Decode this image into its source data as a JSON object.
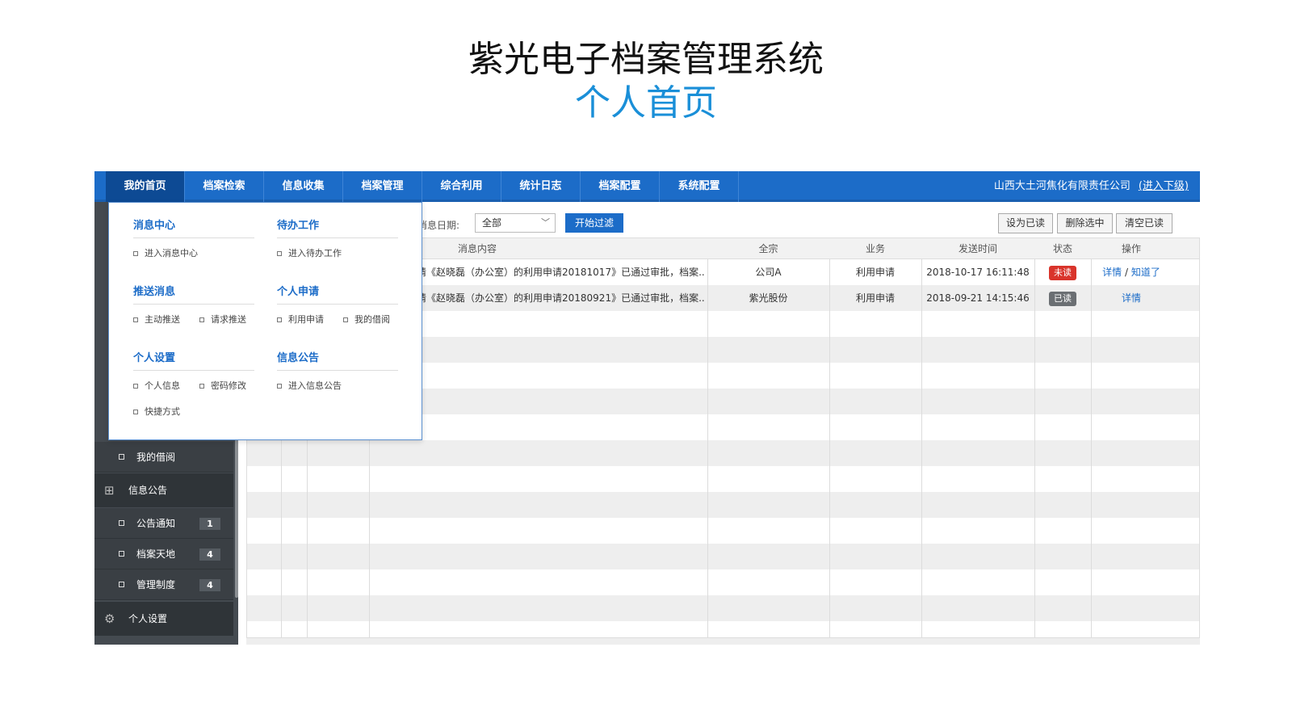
{
  "slide": {
    "title": "紫光电子档案管理系统",
    "subtitle": "个人首页"
  },
  "topnav": {
    "tabs": [
      "我的首页",
      "档案检索",
      "信息收集",
      "档案管理",
      "综合利用",
      "统计日志",
      "档案配置",
      "系统配置"
    ],
    "active_tab": "我的首页",
    "company": "山西大土河焦化有限责任公司",
    "enter_sub": "(进入下级)"
  },
  "dropdown": {
    "sections": [
      {
        "title": "消息中心",
        "items": [
          "进入消息中心"
        ]
      },
      {
        "title": "待办工作",
        "items": [
          "进入待办工作"
        ]
      },
      {
        "title": "推送消息",
        "items": [
          "主动推送",
          "请求推送"
        ]
      },
      {
        "title": "个人申请",
        "items": [
          "利用申请",
          "我的借阅"
        ]
      },
      {
        "title": "个人设置",
        "items": [
          "个人信息",
          "密码修改",
          "快捷方式"
        ]
      },
      {
        "title": "信息公告",
        "items": [
          "进入信息公告"
        ]
      }
    ]
  },
  "sidebar": {
    "sub_top": {
      "label": "我的借阅"
    },
    "group_notice": {
      "label": "信息公告",
      "icon": "grid-icon"
    },
    "notice_items": [
      {
        "label": "公告通知",
        "count": "1"
      },
      {
        "label": "档案天地",
        "count": "4"
      },
      {
        "label": "管理制度",
        "count": "4"
      }
    ],
    "group_settings": {
      "label": "个人设置",
      "icon": "gear-icon"
    }
  },
  "filter": {
    "date_label": "消息日期:",
    "date_value": "全部",
    "start_button": "开始过滤"
  },
  "actions": {
    "mark_read": "设为已读",
    "delete_selected": "删除选中",
    "clear_read": "清空已读"
  },
  "table": {
    "columns": [
      "消息内容",
      "全宗",
      "业务",
      "发送时间",
      "状态",
      "操作"
    ],
    "rows": [
      {
        "content": "请《赵晓磊（办公室）的利用申请20181017》已通过审批，档案...",
        "fonds": "公司A",
        "business": "利用申请",
        "time": "2018-10-17 16:11:48",
        "status": "未读",
        "op_detail": "详情",
        "op_sep": " / ",
        "op_ack": "知道了"
      },
      {
        "content": "请《赵晓磊（办公室）的利用申请20180921》已通过审批，档案...",
        "fonds": "紫光股份",
        "business": "利用申请",
        "time": "2018-09-21 14:15:46",
        "status": "已读",
        "op_detail": "详情",
        "op_sep": "",
        "op_ack": ""
      }
    ]
  },
  "colors": {
    "nav_blue": "#1c6cc8",
    "active_tab": "#0d4a94",
    "sidebar": "#444a50",
    "unread": "#d9342b",
    "read": "#6b6f73",
    "subtitle": "#1a8fd8"
  }
}
